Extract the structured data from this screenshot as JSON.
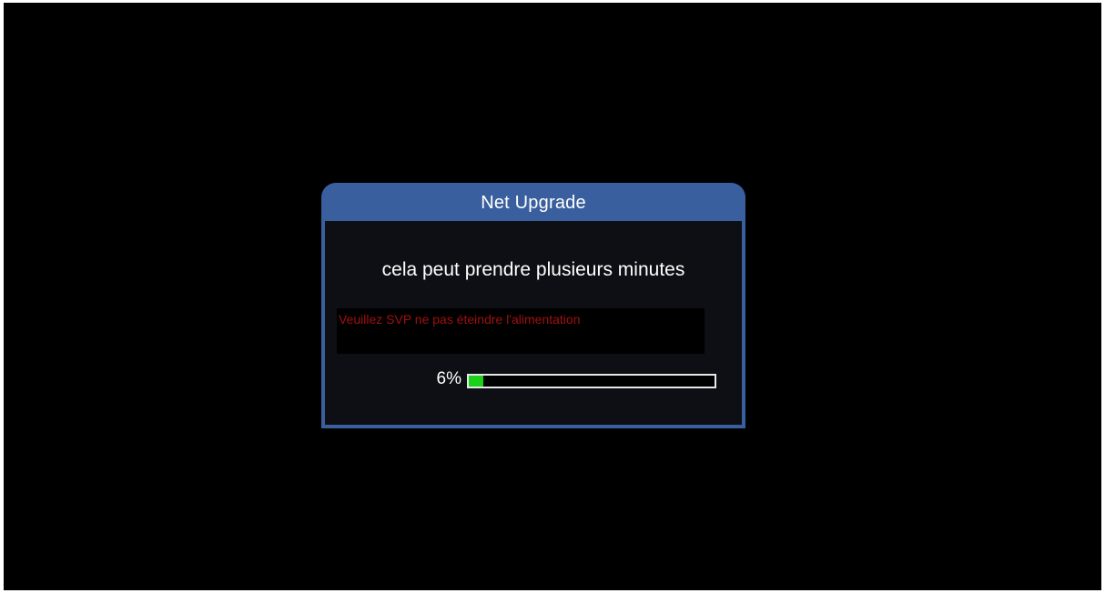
{
  "dialog": {
    "title": "Net Upgrade",
    "message": "cela peut prendre plusieurs minutes",
    "warning": "Veuillez SVP ne pas éteindre l'alimentation",
    "progress": {
      "label": "6%",
      "fraction": 0.06
    }
  },
  "colors": {
    "header": "#3a5f9e",
    "warning_text": "#a01010",
    "progress_fill": "#19d219"
  }
}
